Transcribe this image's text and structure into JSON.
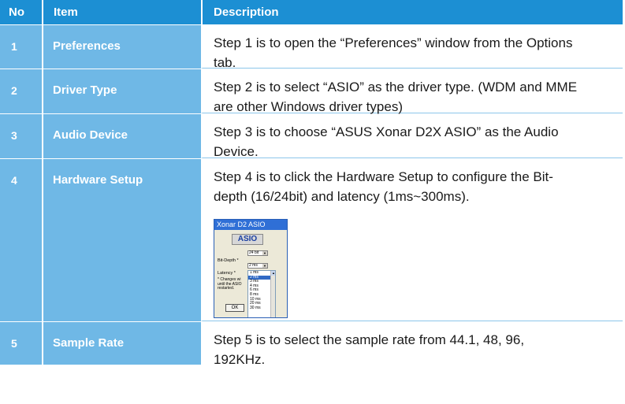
{
  "header": {
    "no": "No",
    "item": "Item",
    "description": "Description"
  },
  "rows": [
    {
      "no": "1",
      "item": "Preferences",
      "desc_lines": [
        "Step 1 is to open the “Preferences” window from the Options",
        "tab."
      ]
    },
    {
      "no": "2",
      "item": "Driver Type",
      "desc_lines": [
        "Step 2 is to select “ASIO” as the driver type. (WDM and MME",
        "are other Windows driver types)"
      ]
    },
    {
      "no": "3",
      "item": "Audio Device",
      "desc_lines": [
        "Step 3 is to choose “ASUS Xonar D2X ASIO” as the Audio",
        "Device."
      ]
    },
    {
      "no": "4",
      "item": "Hardware Setup",
      "desc_lines": [
        "Step 4 is to click the Hardware Setup to configure the Bit-",
        "depth (16/24bit) and latency (1ms~300ms)."
      ]
    },
    {
      "no": "5",
      "item": "Sample Rate",
      "desc_lines": [
        "Step 5 is to select the sample rate from 44.1, 48, 96,",
        "192KHz."
      ]
    }
  ],
  "dialog": {
    "title": "Xonar D2 ASIO",
    "logo": "ASIO",
    "bitdepth_label": "Bit-Depth *",
    "bitdepth_value": "24 bit",
    "latency_label": "Latency *",
    "latency_value": "2 ms",
    "note_lines": [
      "* Changes wi",
      "until the ASIO",
      "restarted."
    ],
    "ok_label": "OK",
    "latency_options": [
      "1 ms",
      "2 ms",
      "3 ms",
      "4 ms",
      "6 ms",
      "8 ms",
      "10 ms",
      "20 ms",
      "30 ms"
    ],
    "selected_option_index": 1,
    "colors": {
      "title_bar": "#2f6fd6",
      "highlight": "#316ac5"
    }
  },
  "colors": {
    "header_bg": "#1c8fd3",
    "row_label_bg": "#6fb8e6",
    "divider": "#8cc6ea"
  }
}
